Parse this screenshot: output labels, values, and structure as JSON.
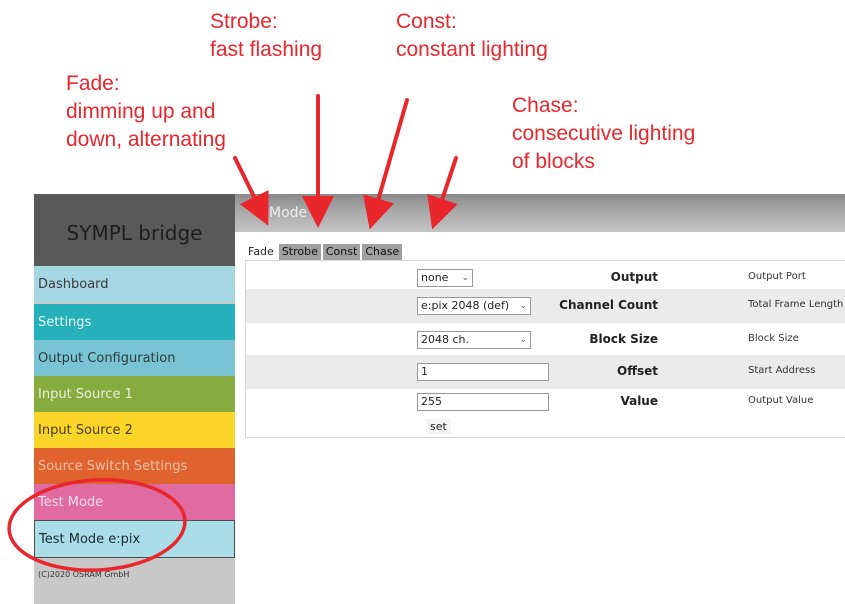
{
  "annotations": {
    "strobe": {
      "title": "Strobe:",
      "desc": "fast flashing"
    },
    "const": {
      "title": "Const:",
      "desc": "constant lighting"
    },
    "fade": {
      "title": "Fade:",
      "line1": "dimming up and",
      "line2": "down, alternating"
    },
    "chase": {
      "title": "Chase:",
      "line1": "consecutive lighting",
      "line2": "of blocks"
    },
    "color": "#e8262b"
  },
  "sidebar": {
    "brand": "SYMPL bridge",
    "items": [
      {
        "label": "Dashboard",
        "color": "#a6d8e4"
      },
      {
        "label": "Settings",
        "color": "#26b0bb"
      },
      {
        "label": "Output Configuration",
        "color": "#78c4d4"
      },
      {
        "label": "Input Source 1",
        "color": "#86ac3f"
      },
      {
        "label": "Input Source 2",
        "color": "#fbd52a"
      },
      {
        "label": "Source Switch Settings",
        "color": "#e0622d"
      },
      {
        "label": "Test Mode",
        "color": "#e06aa2"
      },
      {
        "label": "Test Mode e:pix",
        "color": "#a9dde8"
      }
    ],
    "copyright": "(C)2020 OSRAM GmbH"
  },
  "header": {
    "title": "Mode"
  },
  "tabs": [
    "Fade",
    "Strobe",
    "Const",
    "Chase"
  ],
  "form": {
    "output": {
      "label": "Output",
      "value": "none",
      "help": "Output Port"
    },
    "channel_count": {
      "label": "Channel Count",
      "value": "e:pix 2048 (def)",
      "help": "Total Frame Length"
    },
    "block_size": {
      "label": "Block Size",
      "value": "2048 ch.",
      "help": "Block Size"
    },
    "offset": {
      "label": "Offset",
      "value": "1",
      "help": "Start Address"
    },
    "value": {
      "label": "Value",
      "value": "255",
      "help": "Output Value"
    },
    "set_label": "set"
  },
  "icons": {
    "dropdown": "chevron-down-icon",
    "annotation_arrow": "red-arrow"
  }
}
